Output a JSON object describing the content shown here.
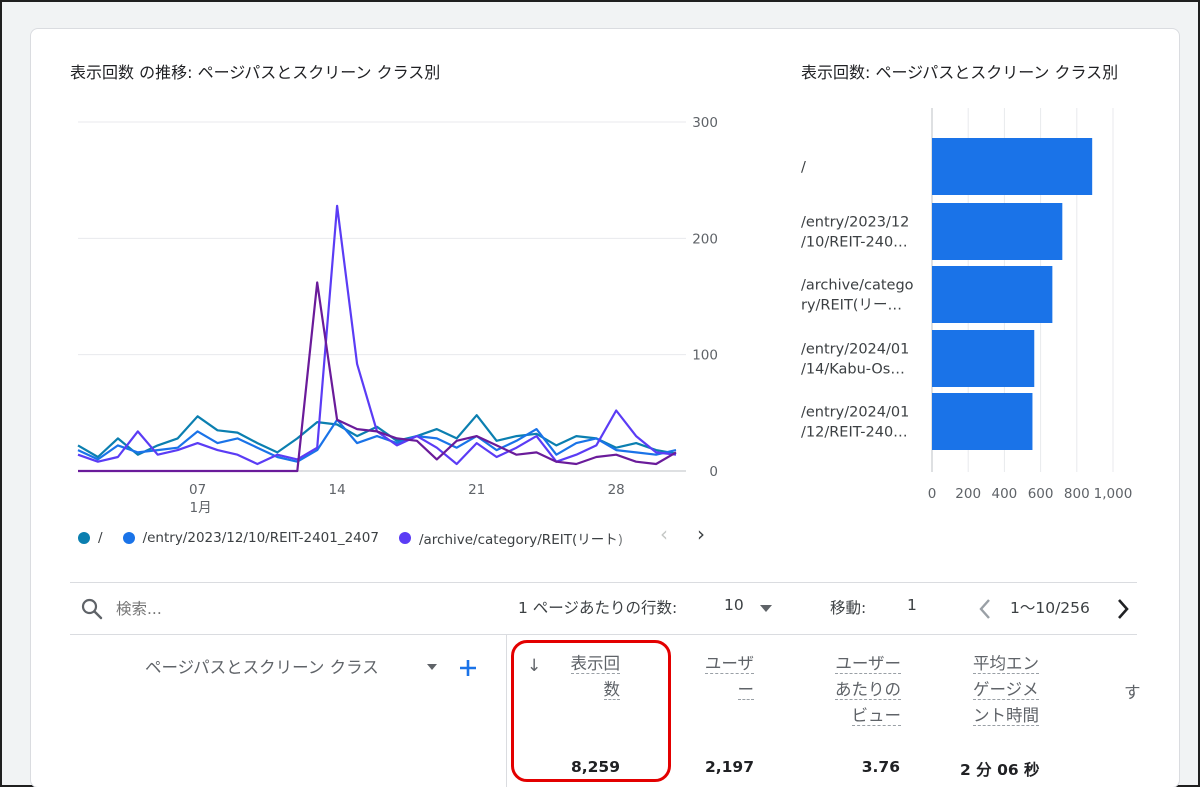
{
  "line_chart": {
    "title": "表示回数 の推移: ページパスとスクリーン クラス別",
    "x_ticks": [
      {
        "label": "07",
        "sub": "1月",
        "day": 7
      },
      {
        "label": "14",
        "sub": "",
        "day": 14
      },
      {
        "label": "21",
        "sub": "",
        "day": 21
      },
      {
        "label": "28",
        "sub": "",
        "day": 28
      }
    ],
    "y_ticks": [
      "300",
      "200",
      "100",
      "0"
    ]
  },
  "bar_chart": {
    "title": "表示回数: ページパスとスクリーン クラス別",
    "x_ticks": [
      "0",
      "200",
      "400",
      "600",
      "800",
      "1,000"
    ]
  },
  "legend": {
    "items": [
      {
        "label": "/",
        "color": "#0b7fb0"
      },
      {
        "label": "/entry/2023/12/10/REIT-2401_2407",
        "color": "#1a73e8"
      },
      {
        "label": "/archive/category/REIT(リート)",
        "color": "#5b3cf5"
      }
    ],
    "prev": "‹",
    "next": "›"
  },
  "toolbar": {
    "search_placeholder": "検索...",
    "rows_label": "1 ページあたりの行数:",
    "rows_value": "10",
    "goto_label": "移動:",
    "goto_value": "1",
    "range": "1〜10/256"
  },
  "table": {
    "dimension_header": "ページパスとスクリーン クラス",
    "columns": [
      {
        "line1": "表示回",
        "line2": "数",
        "line3": "",
        "total": "8,259"
      },
      {
        "line1": "ユーザ",
        "line2": "ー",
        "line3": "",
        "total": "2,197"
      },
      {
        "line1": "ユーザー",
        "line2": "あたりの",
        "line3": "ビュー",
        "total": "3.76"
      },
      {
        "line1": "平均エン",
        "line2": "ゲージメ",
        "line3": "ント時間",
        "total": "2 分 06 秒"
      }
    ],
    "overflow_header": "す"
  },
  "chart_data": [
    {
      "type": "line",
      "title": "表示回数 の推移: ページパスとスクリーン クラス別",
      "x": [
        1,
        2,
        3,
        4,
        5,
        6,
        7,
        8,
        9,
        10,
        11,
        12,
        13,
        14,
        15,
        16,
        17,
        18,
        19,
        20,
        21,
        22,
        23,
        24,
        25,
        26,
        27,
        28,
        29,
        30,
        31
      ],
      "xlabel": "",
      "ylabel": "",
      "ylim": [
        0,
        300
      ],
      "x_ticks": [
        "07",
        "14",
        "21",
        "28"
      ],
      "series": [
        {
          "name": "/",
          "color": "#0b7fb0",
          "values": [
            22,
            12,
            28,
            14,
            22,
            28,
            47,
            35,
            33,
            24,
            16,
            28,
            42,
            40,
            30,
            38,
            26,
            30,
            36,
            28,
            48,
            26,
            30,
            32,
            22,
            30,
            28,
            20,
            24,
            18,
            15
          ]
        },
        {
          "name": "/entry/2023/12/10/REIT-2401_2407",
          "color": "#1a73e8",
          "values": [
            18,
            10,
            22,
            16,
            18,
            20,
            34,
            24,
            28,
            20,
            12,
            8,
            18,
            44,
            24,
            30,
            24,
            30,
            28,
            20,
            30,
            18,
            26,
            36,
            14,
            24,
            28,
            18,
            16,
            14,
            18
          ]
        },
        {
          "name": "/archive/category/REIT(リート)",
          "color": "#5b3cf5",
          "values": [
            14,
            8,
            12,
            34,
            14,
            18,
            24,
            18,
            14,
            6,
            14,
            10,
            20,
            228,
            92,
            34,
            22,
            30,
            20,
            6,
            24,
            12,
            20,
            30,
            8,
            14,
            22,
            52,
            30,
            16,
            14
          ]
        },
        {
          "name": "",
          "color": "#6a1b9a",
          "values": [
            0,
            0,
            0,
            0,
            0,
            0,
            0,
            0,
            0,
            0,
            0,
            0,
            162,
            44,
            36,
            34,
            28,
            26,
            10,
            26,
            30,
            22,
            14,
            16,
            8,
            6,
            12,
            14,
            8,
            6,
            16
          ]
        }
      ]
    },
    {
      "type": "bar",
      "orientation": "horizontal",
      "title": "表示回数: ページパスとスクリーン クラス別",
      "categories": [
        [
          "/",
          ""
        ],
        [
          "/entry/2023/12",
          "/10/REIT-240…"
        ],
        [
          "/archive/catego",
          "ry/REIT(リー…"
        ],
        [
          "/entry/2024/01",
          "/14/Kabu-Os…"
        ],
        [
          "/entry/2024/01",
          "/12/REIT-240…"
        ]
      ],
      "values": [
        885,
        720,
        665,
        565,
        555
      ],
      "xlim": [
        0,
        1000
      ],
      "x_ticks": [
        "0",
        "200",
        "400",
        "600",
        "800",
        "1,000"
      ],
      "color": "#1a73e8"
    }
  ]
}
